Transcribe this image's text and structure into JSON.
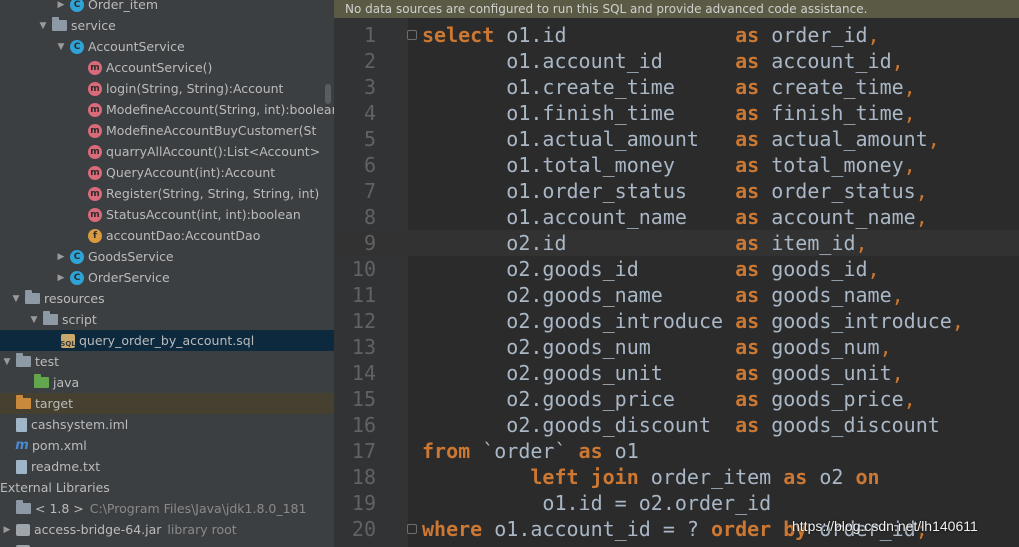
{
  "project_tree": [
    {
      "depth": 6,
      "arrow": "▶",
      "icon": "class",
      "label": "Order_item"
    },
    {
      "depth": 4,
      "arrow": "▼",
      "icon": "package",
      "label": "service"
    },
    {
      "depth": 6,
      "arrow": "▼",
      "icon": "class",
      "label": "AccountService"
    },
    {
      "depth": 8,
      "arrow": "",
      "icon": "method",
      "label": "AccountService()"
    },
    {
      "depth": 8,
      "arrow": "",
      "icon": "method",
      "label": "login(String, String):Account"
    },
    {
      "depth": 8,
      "arrow": "",
      "icon": "method",
      "label": "ModefineAccount(String, int):boolean"
    },
    {
      "depth": 8,
      "arrow": "",
      "icon": "method",
      "label": "ModefineAccountBuyCustomer(St"
    },
    {
      "depth": 8,
      "arrow": "",
      "icon": "method",
      "label": "quarryAllAccount():List<Account>"
    },
    {
      "depth": 8,
      "arrow": "",
      "icon": "method",
      "label": "QueryAccount(int):Account"
    },
    {
      "depth": 8,
      "arrow": "",
      "icon": "method",
      "label": "Register(String, String, String, int)"
    },
    {
      "depth": 8,
      "arrow": "",
      "icon": "method",
      "label": "StatusAccount(int, int):boolean"
    },
    {
      "depth": 8,
      "arrow": "",
      "icon": "field",
      "label": "accountDao:AccountDao"
    },
    {
      "depth": 6,
      "arrow": "▶",
      "icon": "class",
      "label": "GoodsService"
    },
    {
      "depth": 6,
      "arrow": "▶",
      "icon": "class",
      "label": "OrderService"
    },
    {
      "depth": 1,
      "arrow": "▼",
      "icon": "folder",
      "label": "resources"
    },
    {
      "depth": 3,
      "arrow": "▼",
      "icon": "folder",
      "label": "script"
    },
    {
      "depth": 5,
      "arrow": "",
      "icon": "sql",
      "label": "query_order_by_account.sql",
      "selected": true
    },
    {
      "depth": 0,
      "arrow": "▼",
      "icon": "folder",
      "label": "test"
    },
    {
      "depth": 2,
      "arrow": "",
      "icon": "folder-green",
      "label": "java"
    },
    {
      "depth": 0,
      "arrow": "",
      "icon": "folder-orange",
      "label": "target",
      "excluded": true
    },
    {
      "depth": 0,
      "arrow": "",
      "icon": "file",
      "label": "cashsystem.iml"
    },
    {
      "depth": 0,
      "arrow": "",
      "icon": "m",
      "label": "pom.xml"
    },
    {
      "depth": 0,
      "arrow": "",
      "icon": "file",
      "label": "readme.txt"
    },
    {
      "depth": -1,
      "arrow": "",
      "icon": "none",
      "label": "External Libraries"
    },
    {
      "depth": 0,
      "arrow": "",
      "icon": "jdk",
      "label": "< 1.8 >",
      "extra": "C:\\Program Files\\Java\\jdk1.8.0_181"
    },
    {
      "depth": 0,
      "arrow": "▶",
      "icon": "jar",
      "label": "access-bridge-64.jar",
      "extra": "library root"
    },
    {
      "depth": 0,
      "arrow": "▶",
      "icon": "jar",
      "label": "",
      "faint": true
    }
  ],
  "editor": {
    "banner": "No data sources are configured to run this SQL and provide advanced code assistance.",
    "current_line": 9,
    "lines": [
      {
        "n": "1",
        "fold": true,
        "tokens": [
          [
            "kw",
            "select"
          ],
          [
            "t",
            " o1.id              "
          ],
          [
            "kw",
            "as"
          ],
          [
            "t",
            " order_id"
          ],
          [
            "cm",
            ","
          ]
        ]
      },
      {
        "n": "2",
        "tokens": [
          [
            "t",
            "       o1.account_id      "
          ],
          [
            "kw",
            "as"
          ],
          [
            "t",
            " account_id"
          ],
          [
            "cm",
            ","
          ]
        ]
      },
      {
        "n": "3",
        "tokens": [
          [
            "t",
            "       o1.create_time     "
          ],
          [
            "kw",
            "as"
          ],
          [
            "t",
            " create_time"
          ],
          [
            "cm",
            ","
          ]
        ]
      },
      {
        "n": "4",
        "tokens": [
          [
            "t",
            "       o1.finish_time     "
          ],
          [
            "kw",
            "as"
          ],
          [
            "t",
            " finish_time"
          ],
          [
            "cm",
            ","
          ]
        ]
      },
      {
        "n": "5",
        "tokens": [
          [
            "t",
            "       o1.actual_amount   "
          ],
          [
            "kw",
            "as"
          ],
          [
            "t",
            " actual_amount"
          ],
          [
            "cm",
            ","
          ]
        ]
      },
      {
        "n": "6",
        "tokens": [
          [
            "t",
            "       o1.total_money     "
          ],
          [
            "kw",
            "as"
          ],
          [
            "t",
            " total_money"
          ],
          [
            "cm",
            ","
          ]
        ]
      },
      {
        "n": "7",
        "tokens": [
          [
            "t",
            "       o1.order_status    "
          ],
          [
            "kw",
            "as"
          ],
          [
            "t",
            " order_status"
          ],
          [
            "cm",
            ","
          ]
        ]
      },
      {
        "n": "8",
        "tokens": [
          [
            "t",
            "       o1.account_name    "
          ],
          [
            "kw",
            "as"
          ],
          [
            "t",
            " account_name"
          ],
          [
            "cm",
            ","
          ]
        ]
      },
      {
        "n": "9",
        "tokens": [
          [
            "t",
            "       o2.id              "
          ],
          [
            "kw",
            "as"
          ],
          [
            "t",
            " item_id"
          ],
          [
            "cm",
            ","
          ]
        ]
      },
      {
        "n": "10",
        "tokens": [
          [
            "t",
            "       o2.goods_id        "
          ],
          [
            "kw",
            "as"
          ],
          [
            "t",
            " goods_id"
          ],
          [
            "cm",
            ","
          ]
        ]
      },
      {
        "n": "11",
        "tokens": [
          [
            "t",
            "       o2.goods_name      "
          ],
          [
            "kw",
            "as"
          ],
          [
            "t",
            " goods_name"
          ],
          [
            "cm",
            ","
          ]
        ]
      },
      {
        "n": "12",
        "tokens": [
          [
            "t",
            "       o2.goods_introduce "
          ],
          [
            "kw",
            "as"
          ],
          [
            "t",
            " goods_introduce"
          ],
          [
            "cm",
            ","
          ]
        ]
      },
      {
        "n": "13",
        "tokens": [
          [
            "t",
            "       o2.goods_num       "
          ],
          [
            "kw",
            "as"
          ],
          [
            "t",
            " goods_num"
          ],
          [
            "cm",
            ","
          ]
        ]
      },
      {
        "n": "14",
        "tokens": [
          [
            "t",
            "       o2.goods_unit      "
          ],
          [
            "kw",
            "as"
          ],
          [
            "t",
            " goods_unit"
          ],
          [
            "cm",
            ","
          ]
        ]
      },
      {
        "n": "15",
        "tokens": [
          [
            "t",
            "       o2.goods_price     "
          ],
          [
            "kw",
            "as"
          ],
          [
            "t",
            " goods_price"
          ],
          [
            "cm",
            ","
          ]
        ]
      },
      {
        "n": "16",
        "tokens": [
          [
            "t",
            "       o2.goods_discount  "
          ],
          [
            "kw",
            "as"
          ],
          [
            "t",
            " goods_discount"
          ]
        ]
      },
      {
        "n": "17",
        "tokens": [
          [
            "kw",
            "from"
          ],
          [
            "t",
            " `order` "
          ],
          [
            "kw",
            "as"
          ],
          [
            "t",
            " o1"
          ]
        ]
      },
      {
        "n": "18",
        "tokens": [
          [
            "t",
            "         "
          ],
          [
            "kw",
            "left join"
          ],
          [
            "t",
            " order_item "
          ],
          [
            "kw",
            "as"
          ],
          [
            "t",
            " o2 "
          ],
          [
            "kw",
            "on"
          ]
        ]
      },
      {
        "n": "19",
        "tokens": [
          [
            "t",
            "          o1.id = o2.order_id"
          ]
        ]
      },
      {
        "n": "20",
        "fold": true,
        "tokens": [
          [
            "kw",
            "where"
          ],
          [
            "t",
            " o1.account_id = ? "
          ],
          [
            "kw",
            "order by"
          ],
          [
            "t",
            " order_id"
          ],
          [
            "cm",
            ";"
          ]
        ]
      }
    ]
  },
  "watermark": "https://blog.csdn.net/lh140611"
}
